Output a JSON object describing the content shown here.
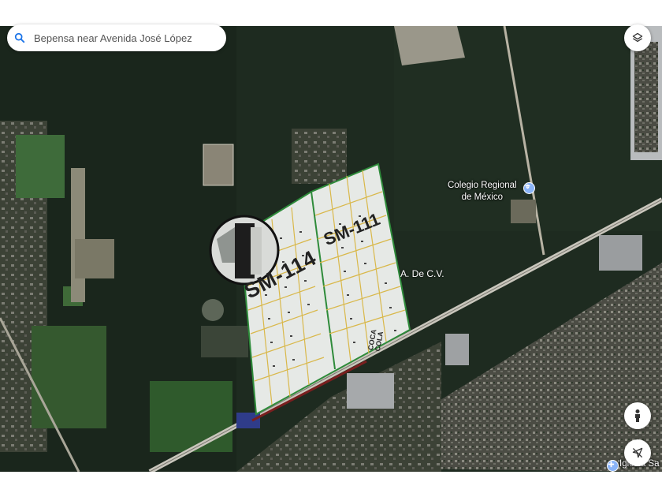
{
  "search": {
    "value": "Bepensa near Avenida José López"
  },
  "poi": [
    {
      "name": "Colegio Regional\nde México",
      "icon": "school-pin-icon"
    },
    {
      "name": "Iglesia Sa",
      "icon": "church-pin-icon"
    }
  ],
  "plan_overlay": {
    "sector_a": "SM-114",
    "sector_b": "SM-111",
    "company_fragment": "A. De C.V.",
    "lot_label": "COCA COLA"
  },
  "controls": {
    "layers": "layers-icon",
    "street_view": "pegman-icon",
    "location": "location-off-icon"
  },
  "colors": {
    "forest": "#1d2a1f",
    "plan_fill": "#e6e9e6",
    "plan_border": "#2e8b3a",
    "lot_lines": "#d9b84a",
    "pin": "#8ab4f8"
  }
}
